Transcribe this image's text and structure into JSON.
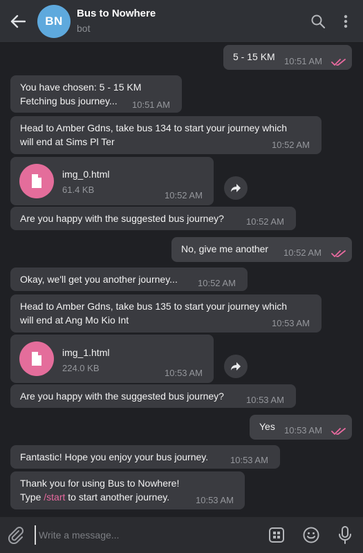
{
  "header": {
    "avatar_initials": "BN",
    "title": "Bus to Nowhere",
    "subtitle": "bot",
    "icons": [
      "back-arrow-icon",
      "search-icon",
      "more-vertical-icon"
    ]
  },
  "messages": [
    {
      "text": "5 - 15 KM",
      "time": "10:51 AM",
      "dir": "out"
    },
    {
      "text_line1": "You have chosen: 5 - 15 KM",
      "text_line2": "Fetching bus journey...",
      "time": "10:51 AM",
      "dir": "in"
    },
    {
      "text_line1": "Head to Amber Gdns, take bus 134 to start your journey which",
      "text_line2": "will end at Sims Pl Ter",
      "time": "10:52 AM",
      "dir": "in"
    },
    {
      "file_name": "img_0.html",
      "file_size": "61.4 KB",
      "time": "10:52 AM",
      "dir": "in"
    },
    {
      "text": "Are you happy with the suggested bus journey?",
      "time": "10:52 AM",
      "dir": "in"
    },
    {
      "text": "No, give me another",
      "time": "10:52 AM",
      "dir": "out"
    },
    {
      "text": "Okay, we'll get you another journey...",
      "time": "10:52 AM",
      "dir": "in"
    },
    {
      "text_line1": "Head to Amber Gdns, take bus 135 to start your journey which",
      "text_line2": "will end at Ang Mo Kio Int",
      "time": "10:53 AM",
      "dir": "in"
    },
    {
      "file_name": "img_1.html",
      "file_size": "224.0 KB",
      "time": "10:53 AM",
      "dir": "in"
    },
    {
      "text": "Are you happy with the suggested bus journey?",
      "time": "10:53 AM",
      "dir": "in"
    },
    {
      "text": "Yes",
      "time": "10:53 AM",
      "dir": "out"
    },
    {
      "text": "Fantastic! Hope you enjoy your bus journey.",
      "time": "10:53 AM",
      "dir": "in"
    },
    {
      "text_line1": "Thank you for using Bus to Nowhere!",
      "line2_prefix": "Type ",
      "line2_command": "/start",
      "line2_suffix": " to start another journey.",
      "time": "10:53 AM",
      "dir": "in"
    }
  ],
  "composer": {
    "placeholder": "Write a message...",
    "icons": [
      "paperclip-icon",
      "bot-keyboard-icon",
      "emoji-icon",
      "microphone-icon"
    ]
  },
  "colors": {
    "header_bg": "#2f3136",
    "chat_bg": "#1f2024",
    "bubble_bg": "#3a3b40",
    "avatar": "#5ea9dd",
    "accent_pink": "#e46d9b",
    "read_ticks": "#e86a9f"
  }
}
